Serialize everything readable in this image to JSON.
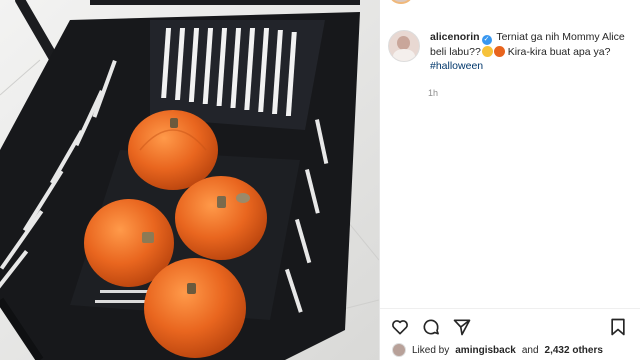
{
  "post": {
    "username": "alicenorin",
    "caption_text": "Terniat ga nih Mommy Alice beli labu??",
    "caption_tail": "Kira-kira buat apa ya?",
    "hashtag": "#halloween",
    "time": "1h",
    "emojis": [
      "smiling-face-emoji",
      "pumpkin-emoji"
    ]
  },
  "likes": {
    "prefix": "Liked by",
    "user": "amingisback",
    "and": "and",
    "count": "2,432 others"
  },
  "actions": {
    "icons": [
      "heart-icon",
      "comment-icon",
      "share-icon",
      "bookmark-icon"
    ]
  },
  "colors": {
    "hashtag": "#00376b",
    "verified": "#3897f0",
    "pumpkin": "#e8641d",
    "basket": "#17181b"
  }
}
